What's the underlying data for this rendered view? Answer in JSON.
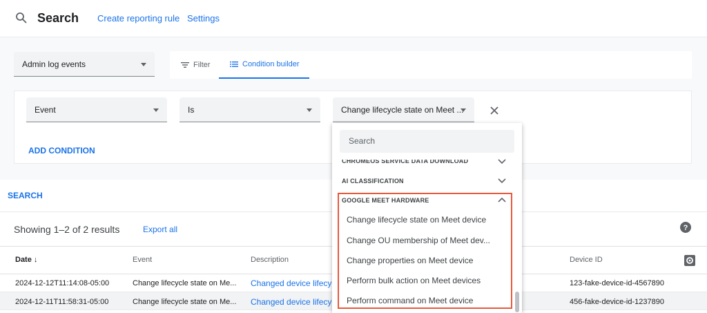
{
  "header": {
    "title": "Search",
    "links": [
      "Create reporting rule",
      "Settings"
    ]
  },
  "source_select": {
    "value": "Admin log events"
  },
  "tabs": {
    "filter": "Filter",
    "condition_builder": "Condition builder"
  },
  "condition": {
    "field": "Event",
    "operator": "Is",
    "value": "Change lifecycle state on Meet ..."
  },
  "add_condition_label": "ADD CONDITION",
  "search_label": "SEARCH",
  "results": {
    "count_text": "Showing 1–2 of 2 results",
    "export_label": "Export all"
  },
  "table": {
    "columns": [
      "Date",
      "Event",
      "Description",
      "Device ID"
    ],
    "rows": [
      {
        "date": "2024-12-12T11:14:08-05:00",
        "event": "Change lifecycle state on Me...",
        "description": "Changed device lifecycl",
        "device_id": "123-fake-device-id-4567890"
      },
      {
        "date": "2024-12-11T11:58:31-05:00",
        "event": "Change lifecycle state on Me...",
        "description": "Changed device lifecycl",
        "device_id": "456-fake-device-id-1237890"
      }
    ]
  },
  "dropdown": {
    "search_placeholder": "Search",
    "groups": [
      "CHROMEOS SERVICE DATA DOWNLOAD",
      "AI CLASSIFICATION",
      "GOOGLE MEET HARDWARE"
    ],
    "items": [
      "Change lifecycle state on Meet device",
      "Change OU membership of Meet dev...",
      "Change properties on Meet device",
      "Perform bulk action on Meet devices",
      "Perform command on Meet device"
    ]
  },
  "colors": {
    "accent": "#1a73e8",
    "highlight": "#e8583a",
    "selected_row": "#f1f3f4"
  }
}
